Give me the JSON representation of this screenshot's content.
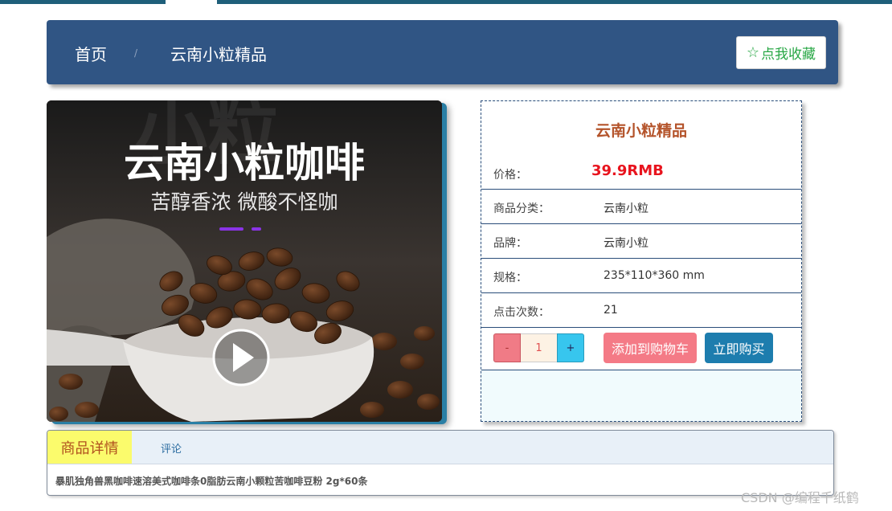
{
  "breadcrumb": {
    "home": "首页",
    "separator": "/",
    "current": "云南小粒精品"
  },
  "favorite_button": {
    "icon": "star-outline-icon",
    "label": "点我收藏"
  },
  "product_image": {
    "headline": "云南小粒咖啡",
    "subline": "苦醇香浓 微酸不怪咖",
    "bg_text": "小粒",
    "play_icon": "play-icon"
  },
  "product": {
    "title": "云南小粒精品",
    "price_label": "价格：",
    "price": "39.9RMB",
    "category_label": "商品分类：",
    "category": "云南小粒",
    "brand_label": "品牌：",
    "brand": "云南小粒",
    "spec_label": "规格：",
    "spec": "235*110*360 mm",
    "clicks_label": "点击次数：",
    "clicks": "21"
  },
  "quantity": {
    "minus": "-",
    "value": "1",
    "plus": "+"
  },
  "actions": {
    "add_to_cart": "添加到购物车",
    "buy_now": "立即购买"
  },
  "tabs": {
    "details": "商品详情",
    "comments": "评论"
  },
  "description": "暴肌独角兽黑咖啡速溶美式咖啡条0脂肪云南小颗粒苦咖啡豆粉 2g*60条",
  "watermark": "CSDN @编程千纸鹤",
  "colors": {
    "header_bg": "#305584",
    "price": "#e8141e",
    "title": "#b4532a",
    "cart_button": "#f47a86",
    "buy_button": "#1d7dae",
    "active_tab": "#fbfb6c"
  }
}
